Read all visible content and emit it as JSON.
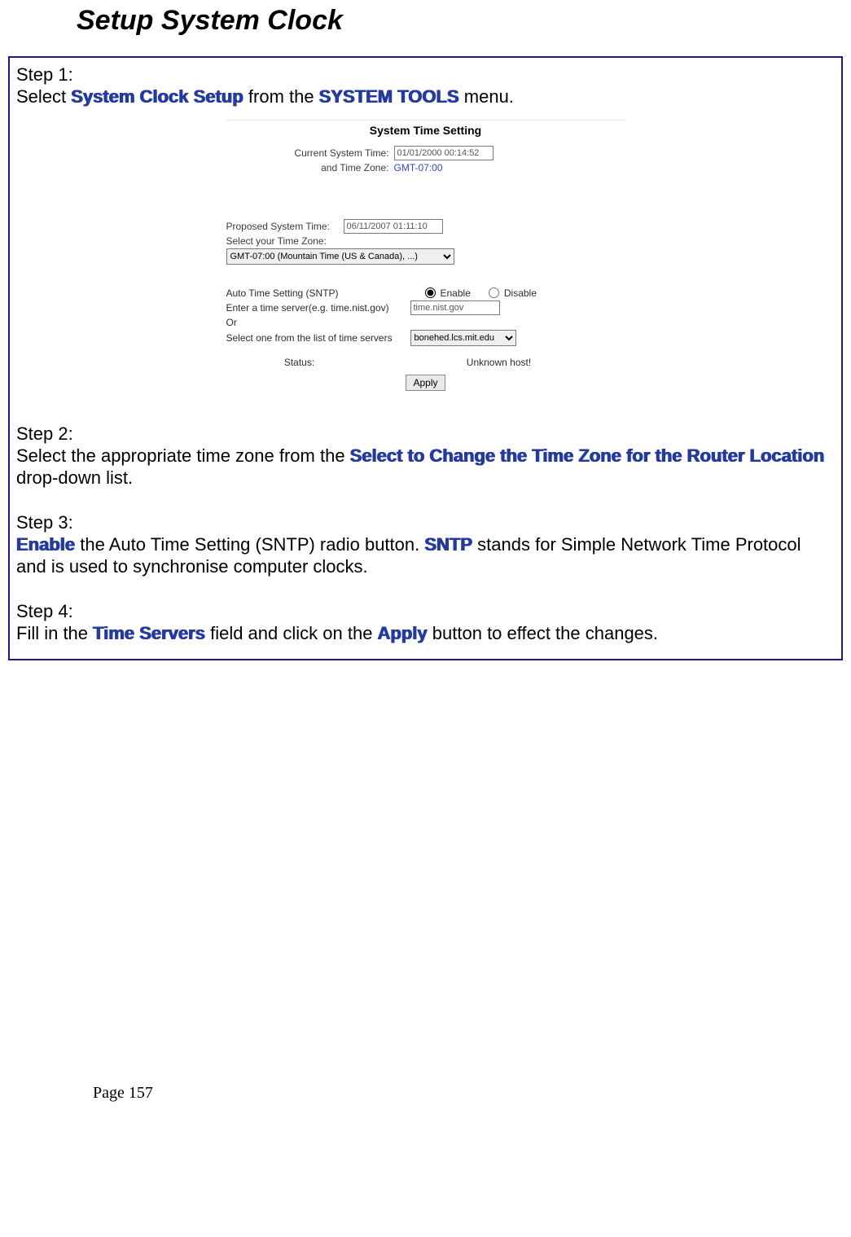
{
  "title": "Setup System Clock",
  "step1": {
    "label": "Step 1:",
    "pre": "Select ",
    "em1": "System Clock Setup",
    "mid": " from the ",
    "em2": "SYSTEM TOOLS",
    "post": " menu."
  },
  "embed": {
    "heading": "System Time Setting",
    "cur_time_label": "Current System Time:",
    "cur_time_value": "01/01/2000 00:14:52",
    "tz_label": "and Time Zone:",
    "tz_value": "GMT-07:00",
    "prop_time_label": "Proposed System Time:",
    "prop_time_value": "06/11/2007 01:11:10",
    "select_tz_label": "Select your Time Zone:",
    "tz_option": "GMT-07:00 (Mountain Time (US & Canada), ...)",
    "auto_label": "Auto Time Setting (SNTP)",
    "enable_label": "Enable",
    "disable_label": "Disable",
    "enter_server_label": "Enter a time server(e.g. time.nist.gov)",
    "server_input_value": "time.nist.gov",
    "or_label": "Or",
    "select_list_label": "Select one from the list of time servers",
    "server_select_value": "bonehed.lcs.mit.edu",
    "status_label": "Status:",
    "status_value": "Unknown host!",
    "apply_label": "Apply"
  },
  "step2": {
    "label": "Step 2:",
    "pre": "Select the appropriate time zone from the ",
    "em1": "Select to Change the Time Zone for the Router Location",
    "post": " drop-down list."
  },
  "step3": {
    "label": "Step 3:",
    "em1": "Enable",
    "mid1": " the Auto Time Setting (SNTP) radio button. ",
    "em2": "SNTP",
    "post": " stands for Simple Network Time Protocol and is used to synchronise computer clocks."
  },
  "step4": {
    "label": "Step 4:",
    "pre": "Fill in the ",
    "em1": "Time Servers",
    "mid": " field and click on the ",
    "em2": "Apply",
    "post": " button to effect the changes."
  },
  "footer": "Page 157"
}
